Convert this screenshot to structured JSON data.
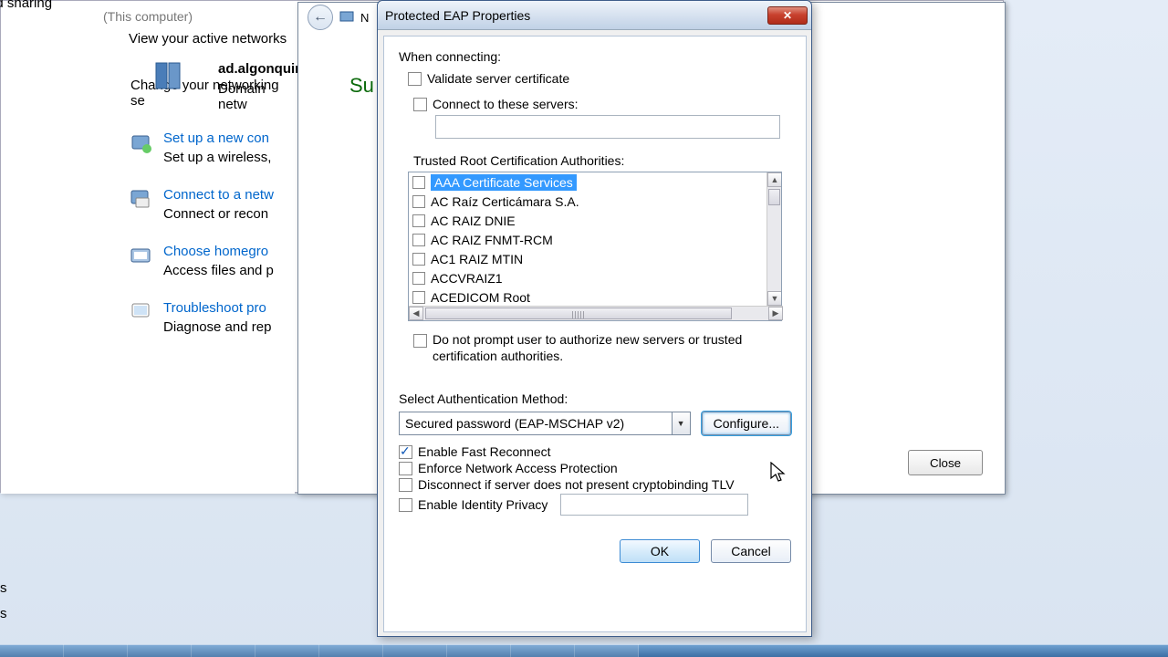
{
  "background": {
    "sharing_heading": "ed sharing",
    "this_computer": "(This computer)",
    "view_networks": "View your active networks",
    "domain_name": "ad.algonquin",
    "domain_sub": "Domain netw",
    "change_heading": "Change your networking se",
    "tasks": [
      {
        "link": "Set up a new con",
        "sub": "Set up a wireless,"
      },
      {
        "link": "Connect to a netw",
        "sub": "Connect or recon"
      },
      {
        "link": "Choose homegro",
        "sub": "Access files and p"
      },
      {
        "link": "Troubleshoot pro",
        "sub": "Diagnose and rep"
      }
    ],
    "left_edge": {
      "line1": "s",
      "line2": "s"
    }
  },
  "mid_window": {
    "su_label": "Su",
    "close_label": "Close"
  },
  "dialog": {
    "title": "Protected EAP Properties",
    "when_connecting": "When connecting:",
    "validate_cert": "Validate server certificate",
    "connect_servers": "Connect to these servers:",
    "servers_value": "",
    "trusted_ca": "Trusted Root Certification Authorities:",
    "ca_list": [
      "AAA Certificate Services",
      "AC Raíz Certicámara S.A.",
      "AC RAIZ DNIE",
      "AC RAIZ FNMT-RCM",
      "AC1 RAIZ MTIN",
      "ACCVRAIZ1",
      "ACEDICOM Root"
    ],
    "no_prompt": "Do not prompt user to authorize new servers or trusted certification authorities.",
    "select_auth": "Select Authentication Method:",
    "auth_method": "Secured password (EAP-MSCHAP v2)",
    "configure": "Configure...",
    "fast_reconnect": "Enable Fast Reconnect",
    "enforce_nap": "Enforce Network Access Protection",
    "disconnect_crypto": "Disconnect if server does not present cryptobinding TLV",
    "identity_privacy": "Enable Identity Privacy",
    "identity_value": "",
    "ok": "OK",
    "cancel": "Cancel"
  }
}
